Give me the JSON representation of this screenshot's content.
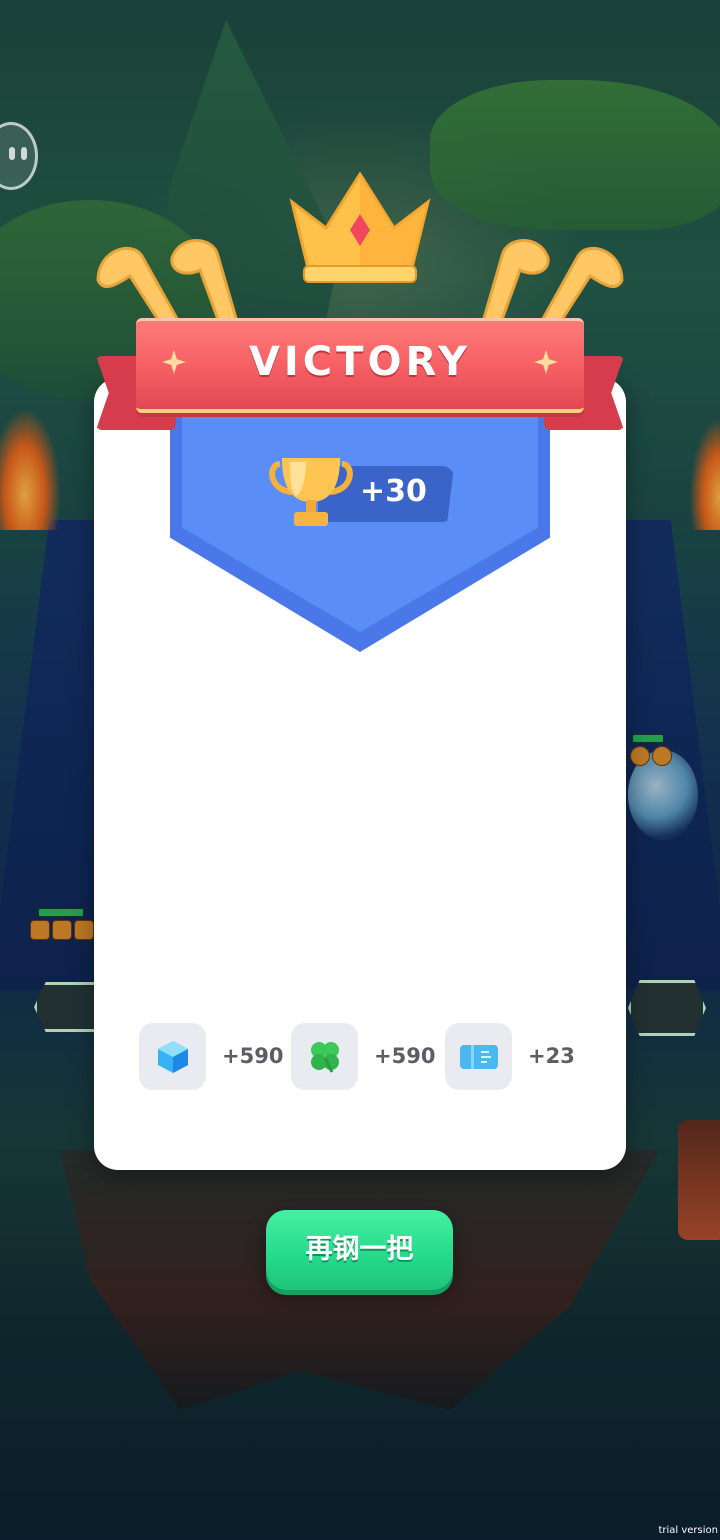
{
  "banner": {
    "title": "VICTORY"
  },
  "trophy_reward": {
    "value": "+30",
    "icon": "trophy-icon"
  },
  "rewards": [
    {
      "icon": "blue-gem-cube-icon",
      "value": "+590"
    },
    {
      "icon": "four-leaf-clover-icon",
      "value": "+590"
    },
    {
      "icon": "ticket-icon",
      "value": "+23"
    }
  ],
  "button": {
    "label": "再钢一把"
  },
  "watermark": "trial version",
  "colors": {
    "banner_red": "#f45e63",
    "shield_blue": "#5a8df5",
    "button_green": "#24d98a",
    "crown_gold": "#ffc14a"
  }
}
